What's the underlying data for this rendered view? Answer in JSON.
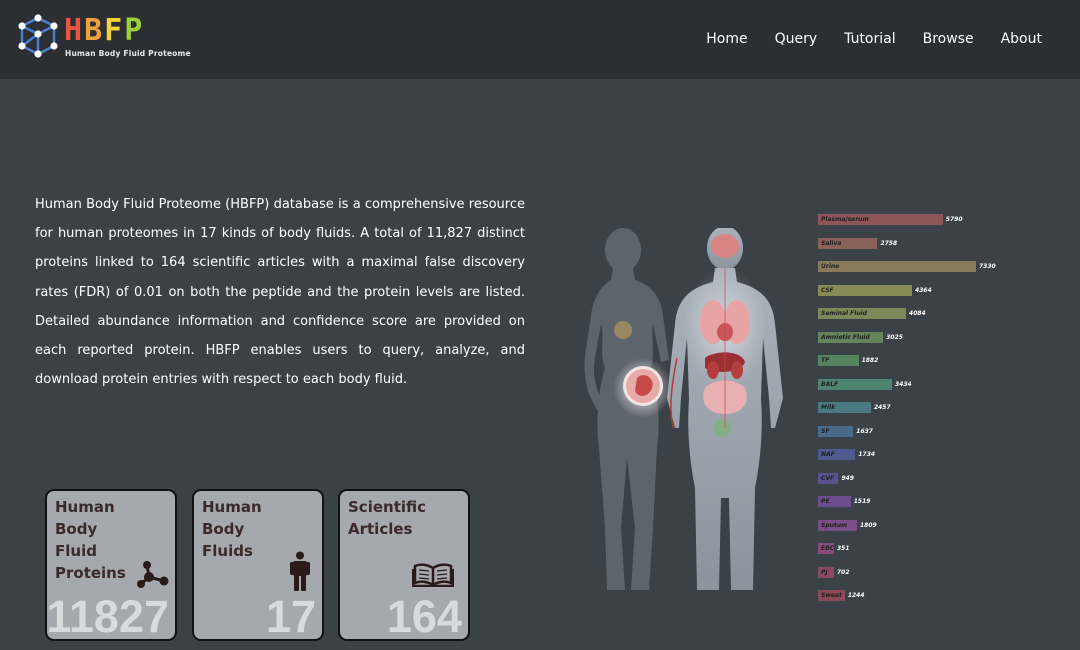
{
  "colors": {
    "navbar_bg": "#2b2f33",
    "page_bg": "#3a4147",
    "card_bg": "#a5a8ac"
  },
  "header": {
    "logo_title": "HBFP",
    "logo_subtitle": "Human Body Fluid Proteome",
    "nav": [
      "Home",
      "Query",
      "Tutorial",
      "Browse",
      "About"
    ]
  },
  "intro": {
    "text": "Human Body Fluid Proteome (HBFP) database is a comprehensive resource for human proteomes in 17 kinds of body fluids. A total of 11,827 distinct proteins linked to 164 scientific articles with a maximal false discovery rates (FDR) of 0.01 on both the peptide and the protein levels are listed. Detailed abundance information and confidence score are provided on each reported protein. HBFP enables users to query, analyze, and download protein entries with respect to each body fluid."
  },
  "stats": [
    {
      "title_lines": [
        "Human",
        "Body",
        "Fluid",
        "Proteins"
      ],
      "value": "11827",
      "icon": "molecule-icon"
    },
    {
      "title_lines": [
        "Human",
        "Body",
        "Fluids"
      ],
      "value": "17",
      "icon": "person-icon"
    },
    {
      "title_lines": [
        "Scientific",
        "Articles"
      ],
      "value": "164",
      "icon": "book-icon"
    }
  ],
  "chart_data": {
    "type": "bar",
    "orientation": "horizontal",
    "categories": [
      "Plasma/serum",
      "Saliva",
      "Urine",
      "CSF",
      "Seminal Fluid",
      "Amniotic Fluid",
      "TF",
      "BALF",
      "Milk",
      "SF",
      "NAF",
      "CVF",
      "PE",
      "Sputum",
      "EBC",
      "PJ",
      "Sweat"
    ],
    "values": [
      5790,
      2758,
      7330,
      4364,
      4084,
      3025,
      1882,
      3434,
      2457,
      1637,
      1734,
      949,
      1519,
      1809,
      351,
      702,
      1244
    ],
    "colors": [
      "#8e5558",
      "#8a6159",
      "#8a7a5c",
      "#8a8a57",
      "#7a8a5a",
      "#65845b",
      "#55845f",
      "#4f8470",
      "#4a7a80",
      "#4a6a8a",
      "#505a8e",
      "#5a5290",
      "#6a4e8c",
      "#7a4e88",
      "#884c7a",
      "#8a4a65",
      "#8a4a58"
    ],
    "xlim": [
      0,
      7330
    ]
  }
}
